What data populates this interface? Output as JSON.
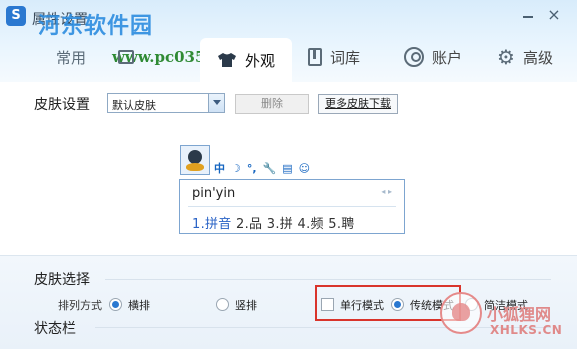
{
  "window": {
    "title": "属性设置",
    "close_glyph": "×"
  },
  "watermarks": {
    "site_name": "河东软件园",
    "site_url": "www.pc0359.cn",
    "brand_name": "小狐狸网",
    "brand_domain": "XHLKS.CN"
  },
  "tabs": [
    {
      "label": "常用",
      "icon": "general-icon"
    },
    {
      "label": "界面",
      "icon": "interface-icon"
    },
    {
      "label": "外观",
      "icon": "tshirt-icon",
      "active": true
    },
    {
      "label": "词库",
      "icon": "book-icon"
    },
    {
      "label": "账户",
      "icon": "account-icon"
    },
    {
      "label": "高级",
      "icon": "gear-icon"
    }
  ],
  "skin_settings": {
    "label": "皮肤设置",
    "selected_skin": "默认皮肤",
    "delete_label": "删除",
    "more_skins_label": "更多皮肤下载"
  },
  "ime_preview": {
    "toolbar": [
      "中",
      "☽",
      "°,",
      "🔧",
      "▤",
      "☺"
    ],
    "pinyin": "pin'yin",
    "arrows": "◂ ▸",
    "candidates_first": "1.拼音",
    "candidates_rest": " 2.品 3.拼 4.频 5.聘"
  },
  "skin_select": {
    "title": "皮肤选择",
    "arrangement_label": "排列方式",
    "horizontal": "横排",
    "vertical": "竖排",
    "single_line_mode": "单行模式",
    "traditional_mode": "传统模式",
    "simple_mode": "简洁模式"
  },
  "status_bar": {
    "title": "状态栏"
  },
  "colors": {
    "accent": "#2a78d0",
    "highlight": "#d9342b"
  }
}
